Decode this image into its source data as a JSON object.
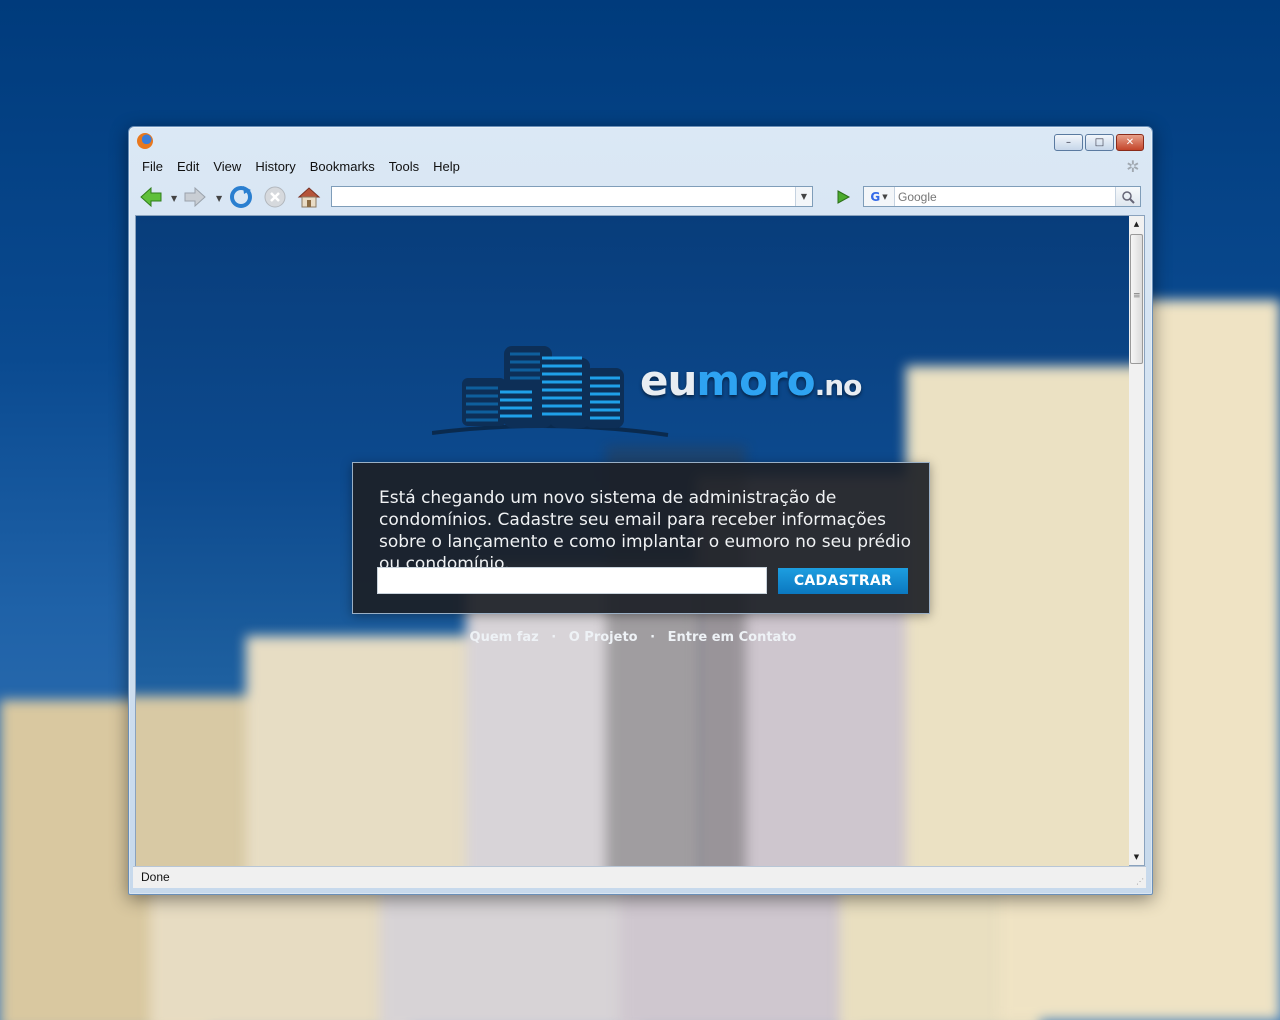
{
  "menu": {
    "items": [
      {
        "label": "File"
      },
      {
        "label": "Edit"
      },
      {
        "label": "View"
      },
      {
        "label": "History"
      },
      {
        "label": "Bookmarks"
      },
      {
        "label": "Tools"
      },
      {
        "label": "Help"
      }
    ]
  },
  "window_controls": {
    "minimize": "–",
    "maximize": "□",
    "close": "✕"
  },
  "navbar": {
    "url_value": "",
    "search_placeholder": "Google",
    "search_engine": "G"
  },
  "status": {
    "text": "Done"
  },
  "page": {
    "logo": {
      "part1": "eu",
      "part2": "moro",
      "part3": ".no"
    },
    "message": "Está chegando um novo sistema de administração de condomínios. Cadastre seu email para receber informações sobre o lançamento e como implantar o eumoro no seu prédio ou condomínio.",
    "email_value": "",
    "submit_label": "CADASTRAR",
    "links": [
      {
        "label": "Quem faz"
      },
      {
        "label": "O Projeto"
      },
      {
        "label": "Entre em Contato"
      }
    ],
    "link_separator": "·"
  },
  "colors": {
    "accent": "#1d9ee0",
    "logo_blue": "#2ea3f2",
    "sky": "#0b4a8c"
  }
}
